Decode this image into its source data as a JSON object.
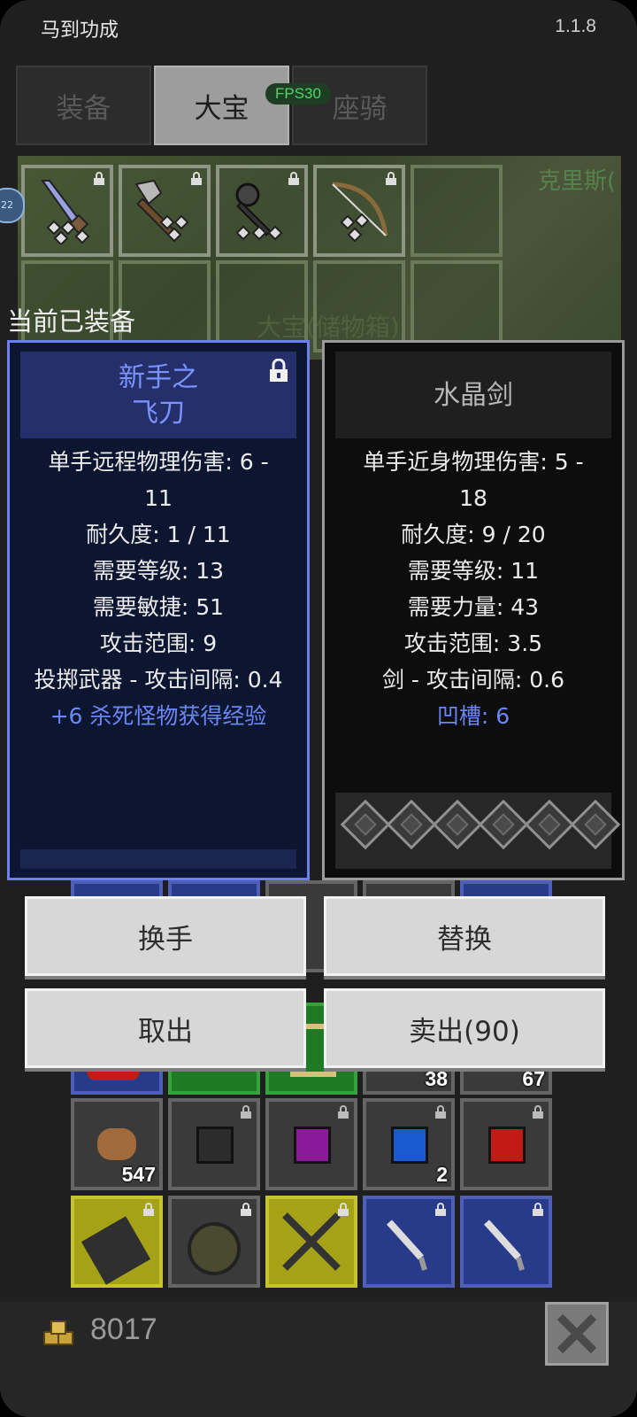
{
  "app": {
    "title": "马到功成",
    "version": "1.1.8"
  },
  "tabs": [
    {
      "label": "装备"
    },
    {
      "label": "大宝"
    },
    {
      "label": "座骑"
    }
  ],
  "fps": "FPS30",
  "stash": {
    "side_badge": "22",
    "npc_text": "克里斯(",
    "label": "大宝(储物箱)"
  },
  "equipped_label": "当前已装备",
  "equipped_item": {
    "name_line1": "新手之",
    "name_line2": "飞刀",
    "stats": [
      "单手远程物理伤害: 6 -",
      "11",
      "耐久度: 1 / 11",
      "需要等级: 13",
      "需要敏捷: 51",
      "攻击范围: 9",
      "投掷武器 - 攻击间隔: 0.4"
    ],
    "bonus": "+6 杀死怪物获得经验",
    "locked_icon": "lock-icon"
  },
  "compare_item": {
    "name": "水晶剑",
    "stats": [
      "单手近身物理伤害: 5 -",
      "18",
      "耐久度: 9 / 20",
      "需要等级: 11",
      "需要力量: 43",
      "攻击范围: 3.5",
      "剑 - 攻击间隔: 0.6"
    ],
    "sockets_label": "凹槽: 6",
    "socket_count": 6
  },
  "buttons": {
    "swap_hand": "换手",
    "replace": "替换",
    "take_out": "取出",
    "sell": "卖出(90)"
  },
  "inventory": {
    "qty_1": "38",
    "qty_2": "67",
    "qty_3": "547",
    "qty_4": "2"
  },
  "footer": {
    "gold": "8017",
    "gold_icon": "gold-coins-icon",
    "close_icon": "close-icon"
  },
  "colors": {
    "equipped_border": "#6d80f0",
    "equipped_name": "#7a93ff",
    "fps_green": "#52d36b"
  }
}
